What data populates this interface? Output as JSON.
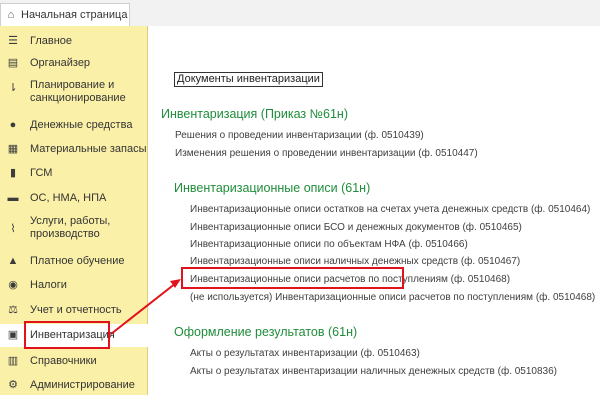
{
  "tab": {
    "label": "Начальная страница",
    "icon": "home-icon"
  },
  "sidebar": {
    "items": [
      {
        "label": "Главное",
        "icon": "menu-icon"
      },
      {
        "label": "Органайзер",
        "icon": "organizer-icon"
      },
      {
        "label": "Планирование и санкционирование",
        "icon": "planning-icon"
      },
      {
        "label": "Денежные средства",
        "icon": "coin-icon"
      },
      {
        "label": "Материальные запасы",
        "icon": "stock-icon"
      },
      {
        "label": "ГСМ",
        "icon": "fuel-icon"
      },
      {
        "label": "ОС, НМА, НПА",
        "icon": "truck-icon"
      },
      {
        "label": "Услуги, работы, производство",
        "icon": "tools-icon"
      },
      {
        "label": "Платное обучение",
        "icon": "graduation-icon"
      },
      {
        "label": "Налоги",
        "icon": "taxes-icon"
      },
      {
        "label": "Учет и отчетность",
        "icon": "scales-icon"
      },
      {
        "label": "Инвентаризация",
        "icon": "inventory-icon"
      },
      {
        "label": "Справочники",
        "icon": "books-icon"
      },
      {
        "label": "Администрирование",
        "icon": "gear-icon"
      }
    ],
    "active_index": 11
  },
  "main": {
    "title": "Документы инвентаризации",
    "sections": [
      {
        "heading": "Инвентаризация (Приказ №61н)",
        "links": [
          "Решения о проведении инвентаризации (ф. 0510439)",
          "Изменения решения о проведении инвентаризации (ф. 0510447)"
        ]
      },
      {
        "heading": "Инвентаризационные описи (61н)",
        "links": [
          "Инвентаризационные описи остатков на счетах учета денежных средств (ф. 0510464)",
          "Инвентаризационные описи БСО и денежных документов (ф. 0510465)",
          "Инвентаризационные описи по объектам НФА (ф. 0510466)",
          "Инвентаризационные описи наличных денежных средств (ф. 0510467)",
          "Инвентаризационные описи расчетов по поступлениям (ф. 0510468)",
          "(не используется) Инвентаризационные описи расчетов по поступлениям (ф. 0510468)"
        ]
      },
      {
        "heading": "Оформление результатов (61н)",
        "links": [
          "Акты о результатах инвентаризации (ф. 0510463)",
          "Акты о результатах инвентаризации наличных денежных средств (ф. 0510836)"
        ]
      }
    ]
  },
  "colors": {
    "sidebar_bg": "#fbf0a8",
    "heading_green": "#1f8d3a",
    "highlight_red": "#e0121c"
  }
}
